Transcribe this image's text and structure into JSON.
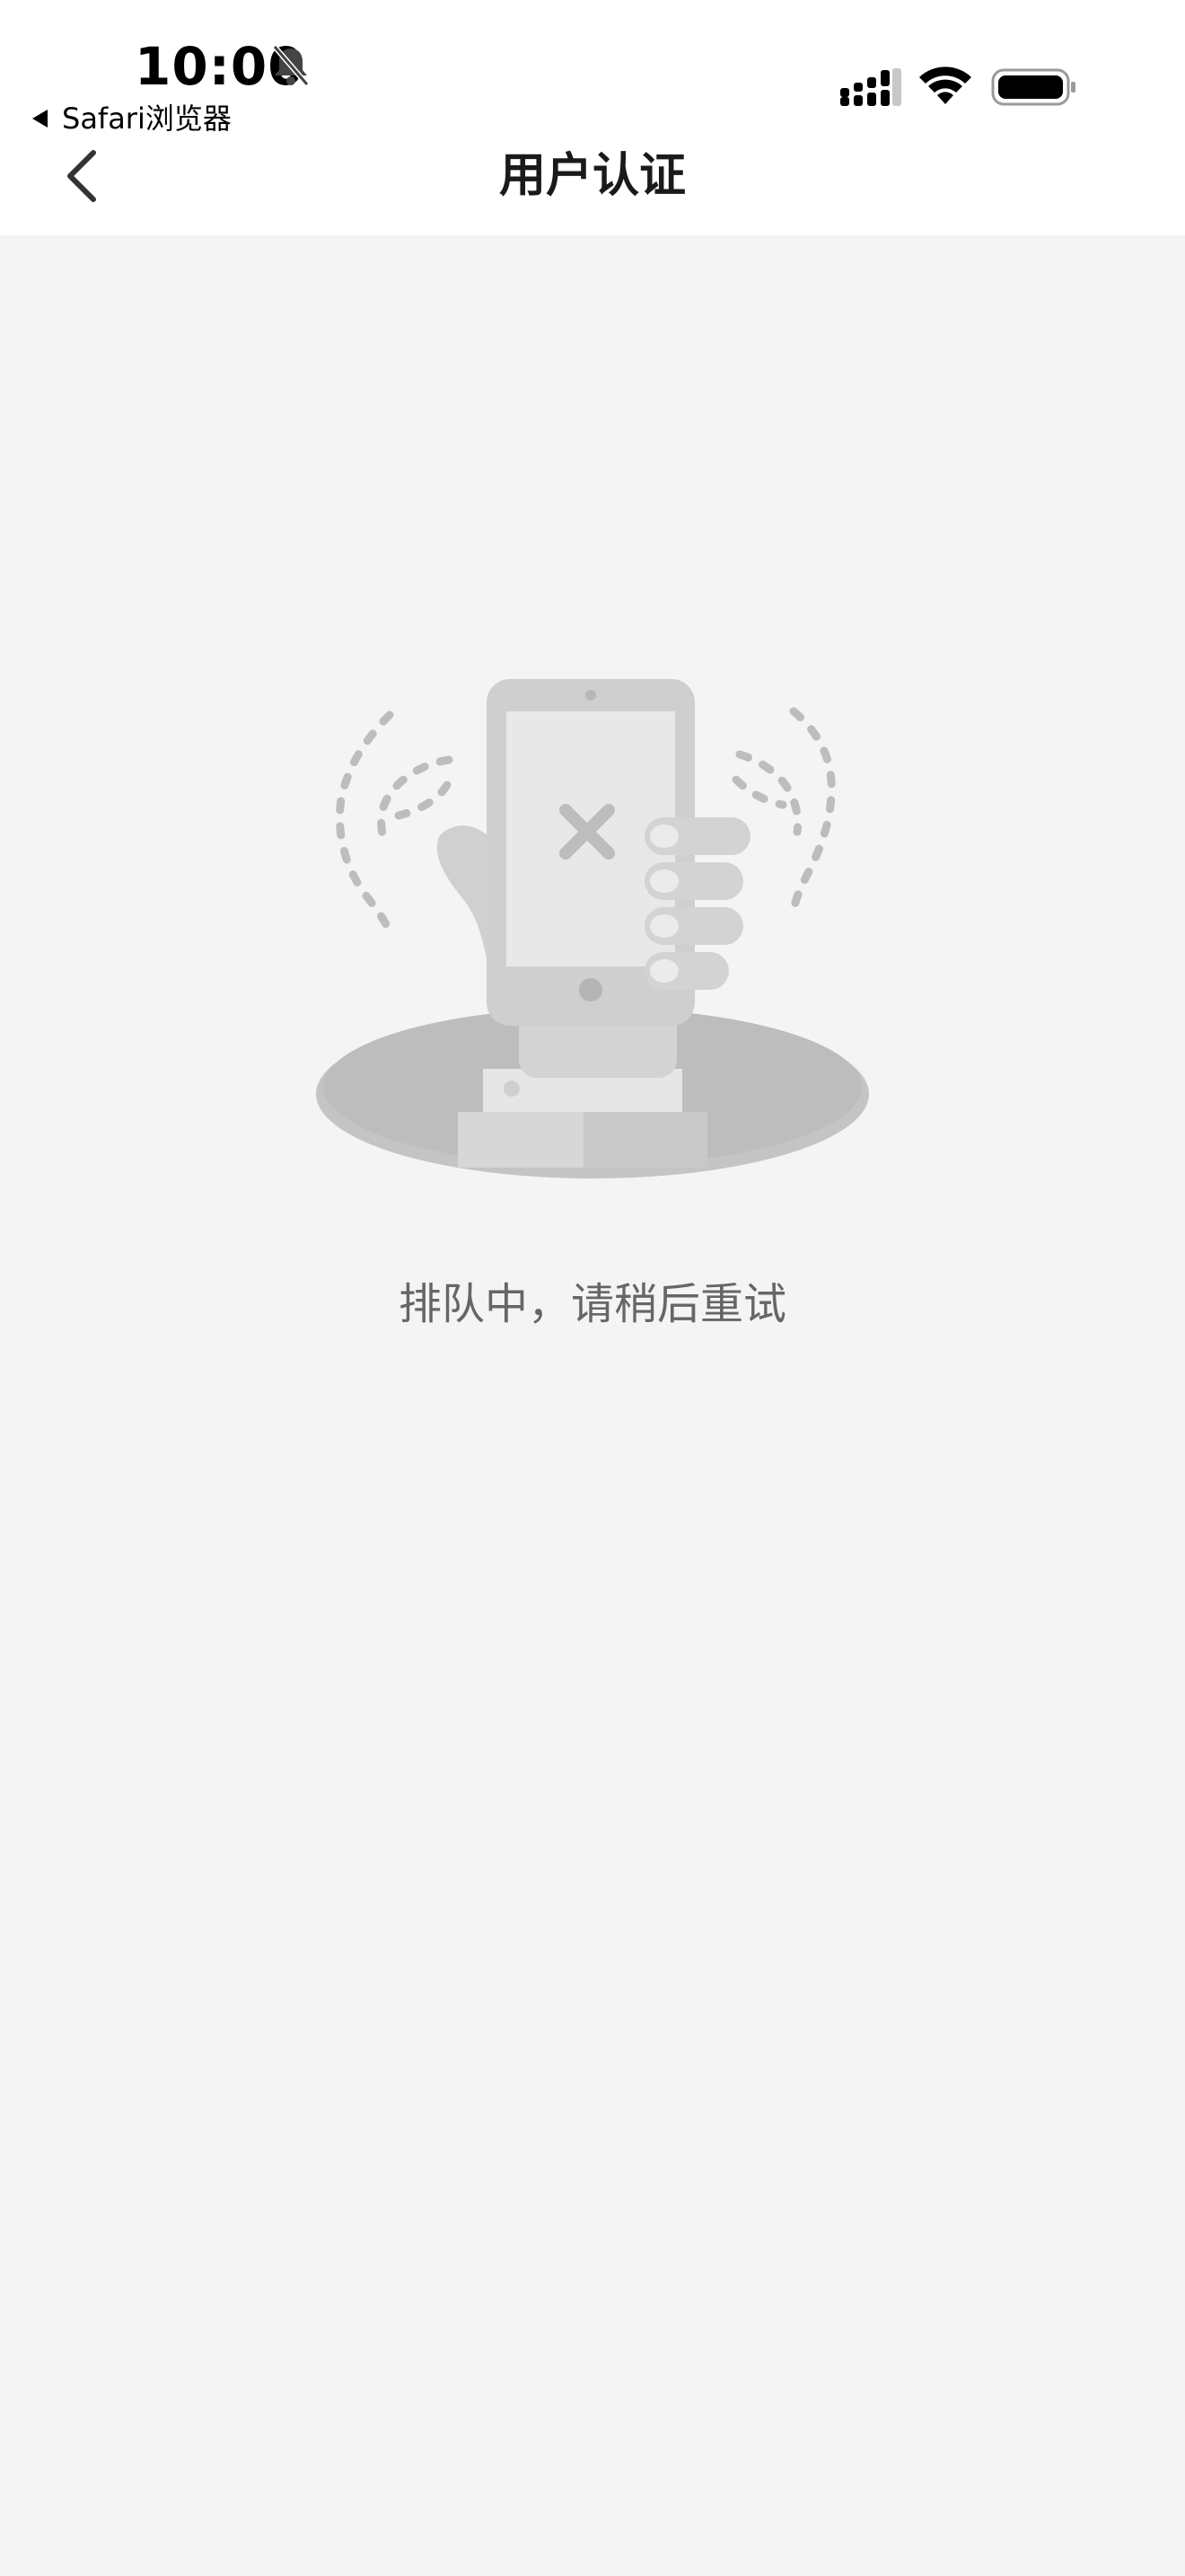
{
  "status_bar": {
    "time": "10:00",
    "back_app_label": "Safari浏览器",
    "icons": [
      "bell-off-icon",
      "signal-icon",
      "wifi-icon",
      "battery-icon"
    ]
  },
  "nav": {
    "title": "用户认证",
    "back_icon": "chevron-left-icon"
  },
  "main": {
    "illustration": "phone-error-hand-illustration",
    "message": "排队中，请稍后重试"
  },
  "colors": {
    "background": "#f4f4f4",
    "topbar": "#ffffff",
    "title_text": "#1a1a1a",
    "message_text": "#666666"
  }
}
